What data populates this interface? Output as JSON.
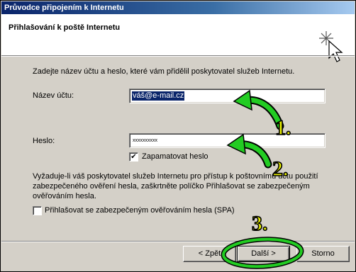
{
  "window": {
    "title": "Průvodce připojením k Internetu"
  },
  "header": {
    "title": "Přihlašování k poště Internetu",
    "icon": "wizard-sparkle-cursor-icon"
  },
  "content": {
    "intro": "Zadejte název účtu a heslo, které vám přidělil poskytovatel služeb Internetu.",
    "account": {
      "label": "Název účtu:",
      "value": "váš@e-mail.cz"
    },
    "password": {
      "label": "Heslo:",
      "value": "xxxxxxxxxx"
    },
    "remember": {
      "label": "Zapamatovat heslo",
      "checked": true
    },
    "spa_description": "Vyžaduje-li váš poskytovatel služeb Internetu pro přístup k poštovnímu účtu použití zabezpečeného ověření hesla, zaškrtněte políčko Přihlašovat se zabezpečeným ověřováním hesla.",
    "spa_lines": [
      "Vyžaduje-li váš poskytovatel služeb Internetu pro přístup k poštovnímu účtu použití",
      "zabezpečeného ověření hesla, zaškrtněte políčko Přihlašovat se zabezpečeným",
      "ověřováním hesla."
    ],
    "spa": {
      "label": "Přihlašovat se zabezpečeným ověřováním hesla (SPA)",
      "checked": false
    }
  },
  "buttons": {
    "back": "< Zpět",
    "next": "Další >",
    "cancel": "Storno"
  },
  "annotations": {
    "step1": "1.",
    "step2": "2.",
    "step3": "3.",
    "color": "#e8f000",
    "arrow_color": "#22cc22"
  }
}
